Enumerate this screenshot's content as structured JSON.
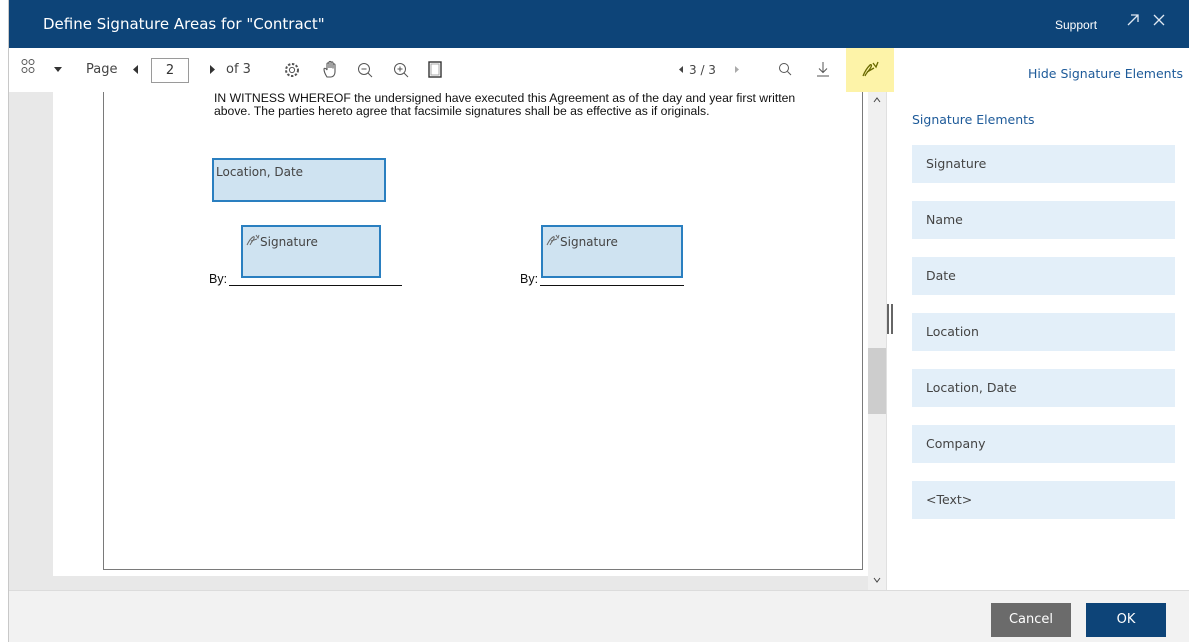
{
  "dialog": {
    "title": "Define Signature Areas for \"Contract\"",
    "support_label": "Support"
  },
  "toolbar": {
    "page_label": "Page",
    "page_value": "2",
    "of_label": "of 3",
    "page_counter": "3 / 3"
  },
  "document": {
    "paragraph": "IN WITNESS WHEREOF the undersigned have executed this Agreement as of the day and year first written above.  The parties hereto agree that facsimile signatures shall be as effective as if originals.",
    "location_box_label": "Location, Date",
    "signature_box_left_label": "Signature",
    "signature_box_right_label": "Signature",
    "by_left": "By:",
    "by_right": "By:"
  },
  "sidebar": {
    "hide_label": "Hide Signature Elements",
    "heading": "Signature Elements",
    "elements": [
      {
        "label": "Signature"
      },
      {
        "label": "Name"
      },
      {
        "label": "Date"
      },
      {
        "label": "Location"
      },
      {
        "label": "Location, Date"
      },
      {
        "label": "Company"
      },
      {
        "label": "<Text>"
      }
    ]
  },
  "footer": {
    "cancel_label": "Cancel",
    "ok_label": "OK"
  },
  "colors": {
    "titlebar": "#0d4478",
    "accent_link": "#1d5a99",
    "signature_box_fill": "#cfe3f1",
    "signature_box_border": "#2a7fc0",
    "element_fill": "#e3eff9",
    "active_tool": "#fdf3a8",
    "cancel_button": "#6b6b6b"
  }
}
